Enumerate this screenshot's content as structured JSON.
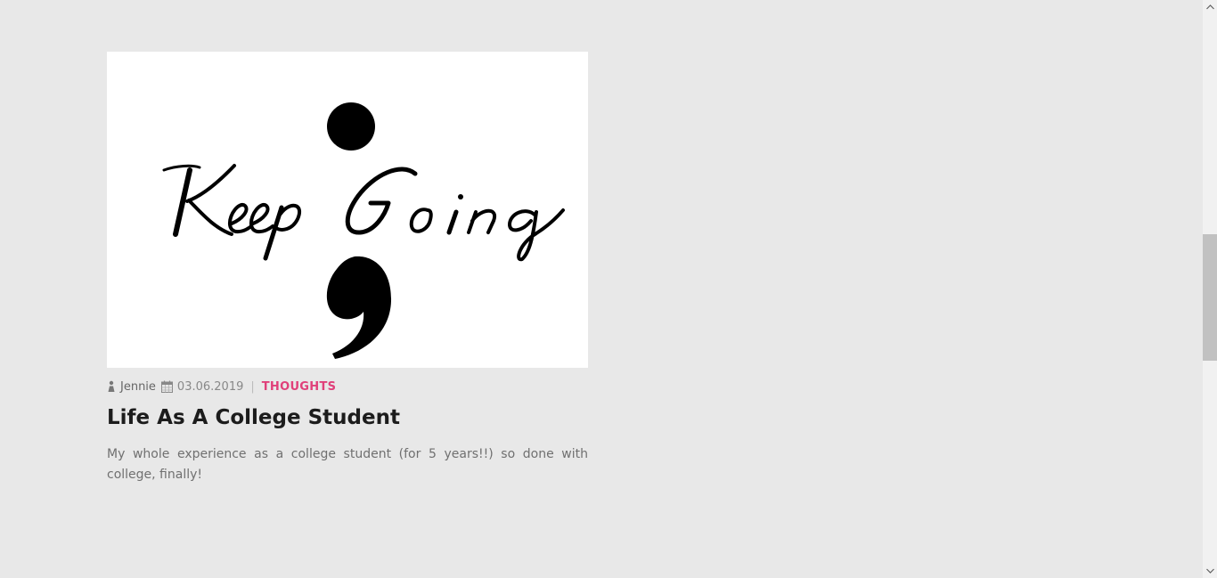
{
  "post": {
    "image_text": "Keep ; Going",
    "author": "Jennie",
    "date": "03.06.2019",
    "separator": "|",
    "category": "THOUGHTS",
    "title": "Life As A College Student",
    "excerpt": "My whole experience as a college student (for 5 years!!) so done with college, finally!"
  },
  "icons": {
    "author": "user-icon",
    "date": "calendar-icon"
  },
  "colors": {
    "background": "#e8e8e8",
    "category": "#e0407a",
    "title": "#1c1c1c",
    "excerpt": "#707070"
  }
}
